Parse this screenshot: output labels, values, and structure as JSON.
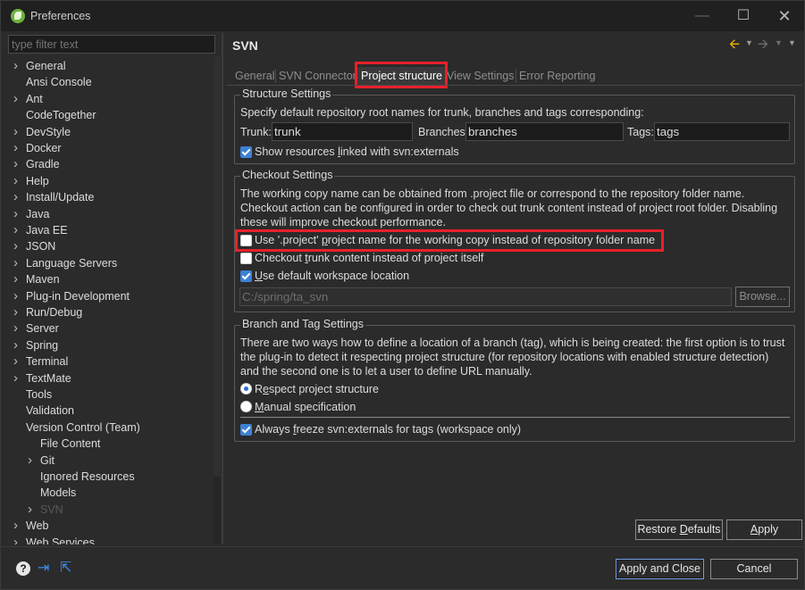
{
  "window": {
    "title": "Preferences",
    "minimize_icon": "minimize-icon",
    "maximize_icon": "maximize-icon",
    "close_icon": "close-icon"
  },
  "sidebar": {
    "filter_placeholder": "type filter text",
    "items": [
      {
        "label": "General",
        "expandable": true,
        "level": 0
      },
      {
        "label": "Ansi Console",
        "expandable": false,
        "level": 0
      },
      {
        "label": "Ant",
        "expandable": true,
        "level": 0
      },
      {
        "label": "CodeTogether",
        "expandable": false,
        "level": 0
      },
      {
        "label": "DevStyle",
        "expandable": true,
        "level": 0
      },
      {
        "label": "Docker",
        "expandable": true,
        "level": 0
      },
      {
        "label": "Gradle",
        "expandable": true,
        "level": 0
      },
      {
        "label": "Help",
        "expandable": true,
        "level": 0
      },
      {
        "label": "Install/Update",
        "expandable": true,
        "level": 0
      },
      {
        "label": "Java",
        "expandable": true,
        "level": 0
      },
      {
        "label": "Java EE",
        "expandable": true,
        "level": 0
      },
      {
        "label": "JSON",
        "expandable": true,
        "level": 0
      },
      {
        "label": "Language Servers",
        "expandable": true,
        "level": 0
      },
      {
        "label": "Maven",
        "expandable": true,
        "level": 0
      },
      {
        "label": "Plug-in Development",
        "expandable": true,
        "level": 0
      },
      {
        "label": "Run/Debug",
        "expandable": true,
        "level": 0
      },
      {
        "label": "Server",
        "expandable": true,
        "level": 0
      },
      {
        "label": "Spring",
        "expandable": true,
        "level": 0
      },
      {
        "label": "Terminal",
        "expandable": true,
        "level": 0
      },
      {
        "label": "TextMate",
        "expandable": true,
        "level": 0
      },
      {
        "label": "Tools",
        "expandable": false,
        "level": 0
      },
      {
        "label": "Validation",
        "expandable": false,
        "level": 0
      },
      {
        "label": "Version Control (Team)",
        "expandable": false,
        "level": 0
      },
      {
        "label": "File Content",
        "expandable": false,
        "level": 1
      },
      {
        "label": "Git",
        "expandable": true,
        "level": 1
      },
      {
        "label": "Ignored Resources",
        "expandable": false,
        "level": 1
      },
      {
        "label": "Models",
        "expandable": false,
        "level": 1
      },
      {
        "label": "SVN",
        "expandable": true,
        "level": 1,
        "selected": true
      },
      {
        "label": "Web",
        "expandable": true,
        "level": 0
      },
      {
        "label": "Web Services",
        "expandable": true,
        "level": 0
      }
    ]
  },
  "header": {
    "title": "SVN",
    "back_icon": "arrow-left-icon",
    "forward_icon": "arrow-right-icon",
    "menu_icon": "chevron-down-icon"
  },
  "tabs": [
    {
      "label": "General",
      "active": false
    },
    {
      "label": "SVN Connector",
      "active": false
    },
    {
      "label": "Project structure",
      "active": true
    },
    {
      "label": "View Settings",
      "active": false
    },
    {
      "label": "Error Reporting",
      "active": false
    }
  ],
  "structure_settings": {
    "title": "Structure Settings",
    "description": "Specify default repository root names for trunk, branches and tags corresponding:",
    "trunk_label": "Trunk:",
    "trunk_value": "trunk",
    "branches_label": "Branches:",
    "branches_value": "branches",
    "tags_label": "Tags:",
    "tags_value": "tags",
    "show_externals_pre": "Show resources ",
    "show_externals_mnemonic": "l",
    "show_externals_post": "inked with svn:externals",
    "show_externals_checked": true
  },
  "checkout_settings": {
    "title": "Checkout Settings",
    "description_1": "The working copy name can be obtained from .project file or correspond to the repository folder name.",
    "description_2": "Checkout action can be configured in order to check out trunk content instead of project root folder. Disabling",
    "description_3": "these will improve checkout performance.",
    "use_project_name_pre": "Use '.project' ",
    "use_project_name_mnemonic": "p",
    "use_project_name_post": "roject name for the working copy instead of repository folder name",
    "use_project_name_checked": false,
    "checkout_trunk_pre": "Checkout ",
    "checkout_trunk_mnemonic": "t",
    "checkout_trunk_post": "runk content instead of project itself",
    "checkout_trunk_checked": false,
    "default_workspace_mnemonic": "U",
    "default_workspace_post": "se default workspace location",
    "default_workspace_checked": true,
    "location_value": "C:/spring/ta_svn",
    "browse_label": "Browse..."
  },
  "branch_tag_settings": {
    "title": "Branch and Tag Settings",
    "description_1": "There are two ways how to define a location of a branch (tag), which is being created: the first option is to trust",
    "description_2": "the plug-in to detect it respecting project structure (for repository locations with enabled structure detection)",
    "description_3": "and the second one is to let a user to define URL manually.",
    "respect_pre": "R",
    "respect_mnemonic": "e",
    "respect_post": "spect project structure",
    "respect_selected": true,
    "manual_mnemonic": "M",
    "manual_post": "anual specification",
    "manual_selected": false,
    "freeze_pre": "Always ",
    "freeze_mnemonic": "f",
    "freeze_post": "reeze svn:externals for tags (workspace only)",
    "freeze_checked": true
  },
  "buttons": {
    "restore_pre": "Restore ",
    "restore_mnemonic": "D",
    "restore_post": "efaults",
    "apply_mnemonic": "A",
    "apply_post": "pply",
    "apply_close": "Apply and Close",
    "cancel": "Cancel"
  },
  "footer_icons": {
    "help": "?",
    "import": "import-icon",
    "export": "export-icon"
  },
  "colors": {
    "accent": "#3b82d6",
    "highlight_box": "#e8202a",
    "background": "#2b2b2b"
  }
}
